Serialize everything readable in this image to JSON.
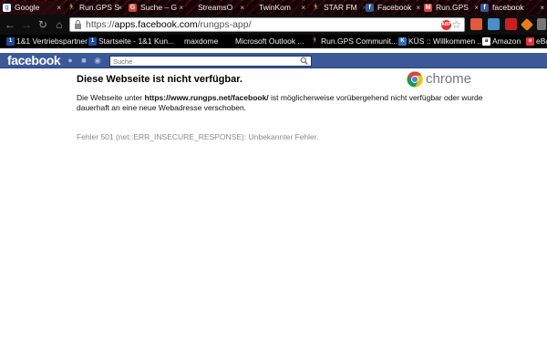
{
  "tabs": [
    {
      "label": "Google",
      "icon": "google-favicon",
      "color": "#ffffff"
    },
    {
      "label": "Run.GPS S",
      "icon": "runner-favicon",
      "color": "#c0c0c0"
    },
    {
      "label": "Suche – G",
      "icon": "search-favicon",
      "color": "#d44638"
    },
    {
      "label": "StreamsO",
      "icon": "none",
      "color": ""
    },
    {
      "label": "TwinKom",
      "icon": "none",
      "color": ""
    },
    {
      "label": "STAR FM",
      "icon": "runner-favicon",
      "color": "#c0c0c0"
    },
    {
      "label": "Facebook",
      "icon": "facebook-favicon",
      "color": "#3b5998"
    },
    {
      "label": "Run.GPS",
      "icon": "gmail-favicon",
      "color": "#d44638"
    },
    {
      "label": "facebook",
      "icon": "facebook-favicon",
      "color": "#3b5998"
    }
  ],
  "omnibox": {
    "scheme": "https://",
    "host": "apps.facebook.com",
    "path": "/rungps-app/",
    "keyword_badge": "ABP"
  },
  "bookmarks": [
    {
      "label": "1&1 Vertriebspartner",
      "icon": "1und1-icon",
      "color": "#1f4a9c"
    },
    {
      "label": "Startseite - 1&1 Kun...",
      "icon": "1und1-icon",
      "color": "#1f4a9c"
    },
    {
      "label": "maxdome",
      "icon": "none",
      "color": ""
    },
    {
      "label": "Microsoft Outlook ...",
      "icon": "none",
      "color": ""
    },
    {
      "label": "Run.GPS Communit...",
      "icon": "runner-icon",
      "color": "#888888"
    },
    {
      "label": "KÜS :: Willkommen ...",
      "icon": "kues-icon",
      "color": "#2d6fb5"
    },
    {
      "label": "Amazon",
      "icon": "amazon-icon",
      "color": "#ffffff"
    },
    {
      "label": "eBa",
      "icon": "ebay-icon",
      "color": "#e53238"
    }
  ],
  "facebook": {
    "logo": "facebook",
    "search_placeholder": "Suche"
  },
  "error": {
    "title": "Diese Webseite ist nicht verfügbar.",
    "brand": "chrome",
    "body_prefix": "Die Webseite unter ",
    "body_url": "https://www.rungps.net/facebook/",
    "body_suffix": " ist möglicherweise vorübergehend nicht verfügbar oder wurde dauerhaft an eine neue Webadresse verschoben.",
    "code": "Fehler 501 (net::ERR_INSECURE_RESPONSE): Unbekannter Fehler."
  },
  "colors": {
    "facebook_blue": "#3b5998",
    "chrome_red": "#db4437",
    "chrome_yellow": "#f4c20d",
    "chrome_green": "#0f9d58",
    "chrome_blue": "#4285f4"
  }
}
